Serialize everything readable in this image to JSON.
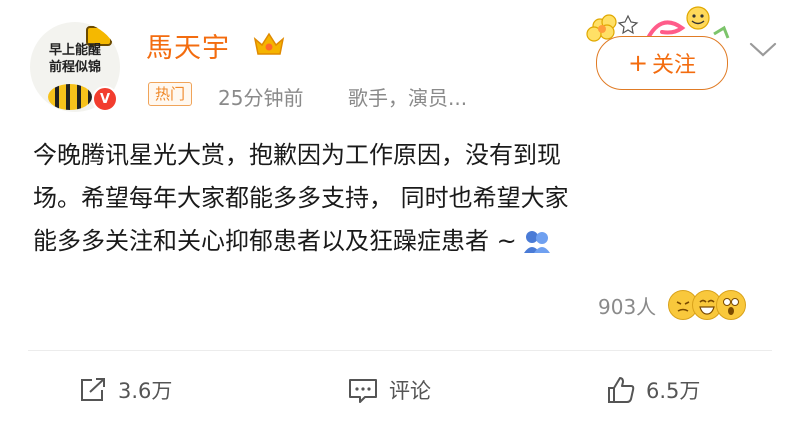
{
  "post": {
    "avatar_caption_line1": "早上能醒",
    "avatar_caption_line2": "前程似锦",
    "verified_mark": "V",
    "username": "馬天宇",
    "hot_tag": "热门",
    "time": "25分钟前",
    "tags": "歌手，演员...",
    "follow_label": "关注",
    "follow_plus": "+",
    "text_line1": "今晚腾讯星光大赏，抱歉因为工作原因，没有到现",
    "text_line2": "场。希望每年大家都能多多支持， 同时也希望大家",
    "text_line3": "能多多关注和关心抑郁患者以及狂躁症患者 ~",
    "reaction_count": "903人"
  },
  "actions": {
    "repost_count": "3.6万",
    "comment_label": "评论",
    "like_count": "6.5万"
  },
  "colors": {
    "accent": "#f36c0f",
    "text": "#1a1a1a",
    "muted": "#8a8a8a"
  },
  "icons": [
    "vip-crown-icon",
    "chevron-down-icon",
    "repost-icon",
    "comment-icon",
    "like-icon",
    "hug-emoji-icon"
  ]
}
